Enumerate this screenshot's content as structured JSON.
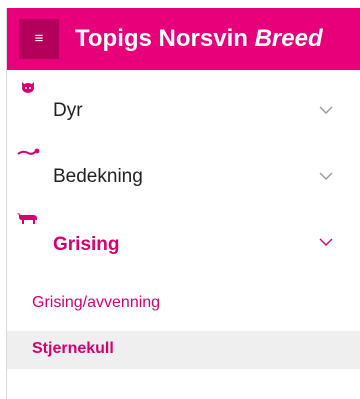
{
  "header": {
    "menu_icon": "hamburger-icon",
    "brand_name": "Topigs Norsvin",
    "brand_suffix": "Breed",
    "color": "#e8007a"
  },
  "nav": {
    "items": [
      {
        "label": "Dyr",
        "icon": "pig-icon",
        "expanded": false
      },
      {
        "label": "Bedekning",
        "icon": "insemination-icon",
        "expanded": false
      },
      {
        "label": "Grising",
        "icon": "sow-icon",
        "expanded": true
      }
    ],
    "subitems": [
      {
        "label": "Grising/avvenning",
        "selected": false
      },
      {
        "label": "Stjernekull",
        "selected": true
      }
    ]
  },
  "colors": {
    "accent": "#d6006e",
    "selected_bg": "#efefef"
  }
}
